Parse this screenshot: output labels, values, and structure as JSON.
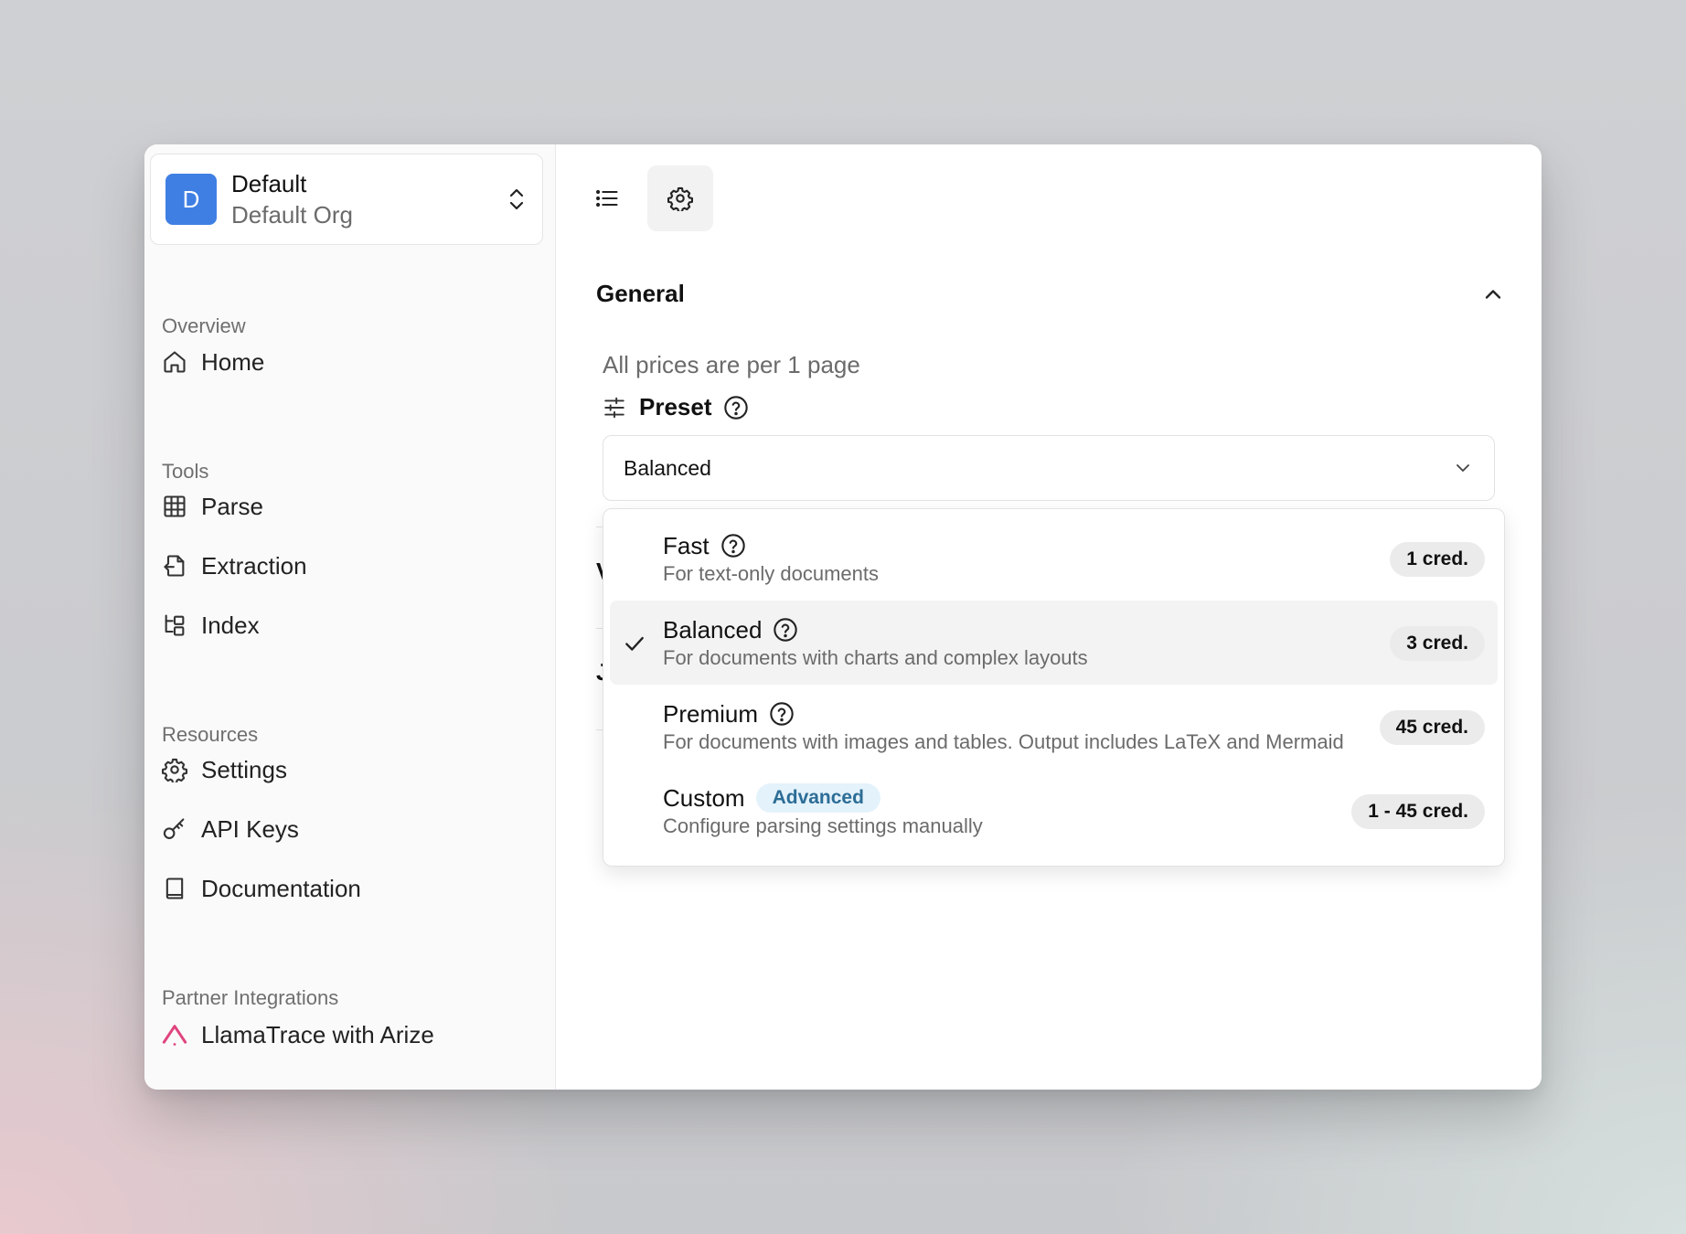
{
  "org": {
    "avatar_letter": "D",
    "name": "Default",
    "subtitle": "Default Org"
  },
  "sidebar": {
    "sections": [
      {
        "label": "Overview",
        "items": [
          {
            "label": "Home",
            "icon": "home-icon"
          }
        ]
      },
      {
        "label": "Tools",
        "items": [
          {
            "label": "Parse",
            "icon": "table-icon"
          },
          {
            "label": "Extraction",
            "icon": "file-export-icon"
          },
          {
            "label": "Index",
            "icon": "tree-icon"
          }
        ]
      },
      {
        "label": "Resources",
        "items": [
          {
            "label": "Settings",
            "icon": "gear-icon"
          },
          {
            "label": "API Keys",
            "icon": "key-icon"
          },
          {
            "label": "Documentation",
            "icon": "book-icon"
          }
        ]
      },
      {
        "label": "Partner Integrations",
        "items": [
          {
            "label": "LlamaTrace with Arize",
            "icon": "arize-logo-icon"
          }
        ]
      }
    ]
  },
  "main": {
    "section_title": "General",
    "price_note": "All prices are per 1 page",
    "preset_label": "Preset",
    "selected_value": "Balanced",
    "behind_chars": [
      "V",
      "J"
    ],
    "options": [
      {
        "title": "Fast",
        "desc": "For text-only documents",
        "badge": "1 cred.",
        "selected": false
      },
      {
        "title": "Balanced",
        "desc": "For documents with charts and complex layouts",
        "badge": "3 cred.",
        "selected": true
      },
      {
        "title": "Premium",
        "desc": "For documents with images and tables. Output includes LaTeX and Mermaid",
        "badge": "45 cred.",
        "selected": false
      },
      {
        "title": "Custom",
        "tag": "Advanced",
        "desc": "Configure parsing settings manually",
        "badge": "1 - 45 cred.",
        "selected": false
      }
    ]
  },
  "colors": {
    "accent": "#3f7fe4",
    "arize": "#e0447e",
    "advanced_bg": "#e4f2fb",
    "advanced_text": "#2c6d96"
  }
}
